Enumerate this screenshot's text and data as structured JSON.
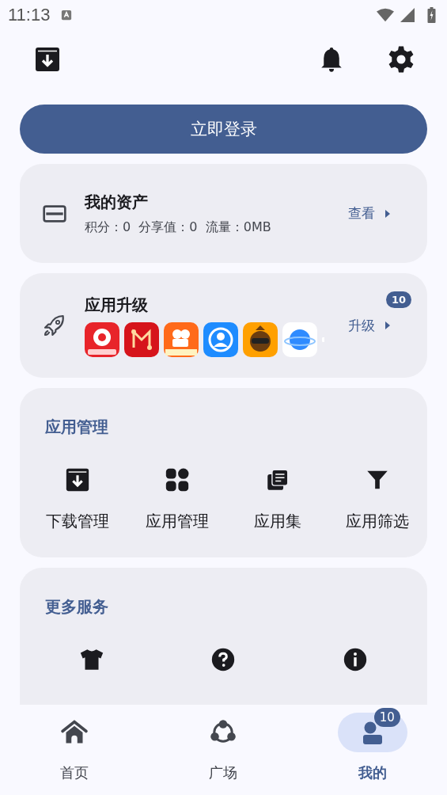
{
  "status_bar": {
    "time": "11:13"
  },
  "login_button": {
    "label": "立即登录"
  },
  "assets_card": {
    "title": "我的资产",
    "details": "积分：0  分享值：0  流量：0MB",
    "action": "查看"
  },
  "upgrade_card": {
    "title": "应用升级",
    "action": "升级",
    "badge": "10",
    "apps": [
      {
        "color": "#e8242a"
      },
      {
        "color": "#d6141b"
      },
      {
        "color": "#ff6a1a"
      },
      {
        "color": "#1e8cff"
      },
      {
        "color": "#ffa000"
      },
      {
        "color": "#ffffff"
      },
      {
        "color": "#ffffff"
      }
    ]
  },
  "management": {
    "title": "应用管理",
    "items": [
      {
        "kind": "download",
        "label": "下载管理"
      },
      {
        "kind": "grid",
        "label": "应用管理"
      },
      {
        "kind": "stack",
        "label": "应用集"
      },
      {
        "kind": "filter",
        "label": "应用筛选"
      }
    ]
  },
  "services": {
    "title": "更多服务",
    "items": [
      {
        "kind": "shirt"
      },
      {
        "kind": "help"
      },
      {
        "kind": "info"
      }
    ]
  },
  "bottom_nav": [
    {
      "kind": "home",
      "label": "首页",
      "selected": false
    },
    {
      "kind": "hub",
      "label": "广场",
      "selected": false
    },
    {
      "kind": "me",
      "label": "我的",
      "selected": true,
      "badge": "10"
    }
  ]
}
